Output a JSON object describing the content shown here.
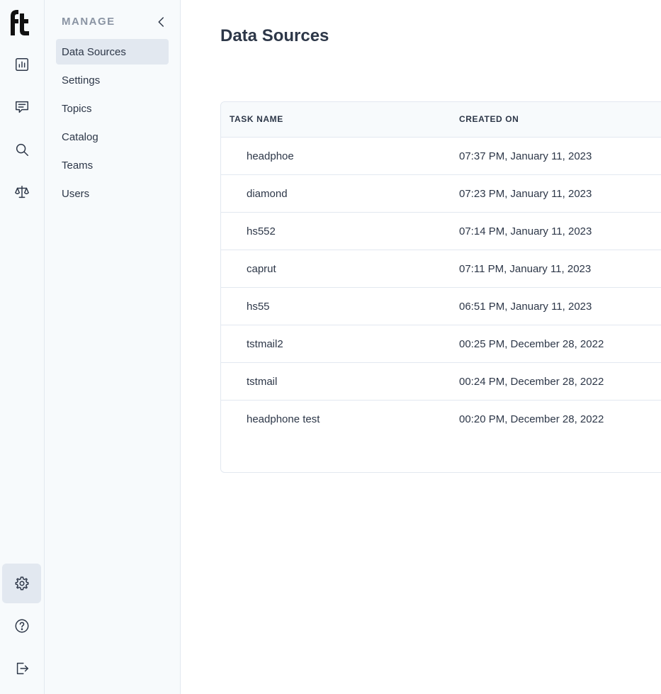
{
  "rail": {
    "logo": "ft",
    "icons": [
      "bar-chart-icon",
      "message-icon",
      "search-icon",
      "scale-icon",
      "gear-icon",
      "help-icon",
      "logout-icon"
    ],
    "active": "gear-icon"
  },
  "panel": {
    "title": "MANAGE",
    "items": [
      {
        "label": "Data Sources",
        "active": true
      },
      {
        "label": "Settings",
        "active": false
      },
      {
        "label": "Topics",
        "active": false
      },
      {
        "label": "Catalog",
        "active": false
      },
      {
        "label": "Teams",
        "active": false
      },
      {
        "label": "Users",
        "active": false
      }
    ]
  },
  "main": {
    "title": "Data Sources",
    "table": {
      "columns": [
        "TASK NAME",
        "CREATED ON"
      ],
      "rows": [
        {
          "name": "headphoe",
          "created": "07:37 PM, January 11, 2023"
        },
        {
          "name": "diamond",
          "created": "07:23 PM, January 11, 2023"
        },
        {
          "name": "hs552",
          "created": "07:14 PM, January 11, 2023"
        },
        {
          "name": "caprut",
          "created": "07:11 PM, January 11, 2023"
        },
        {
          "name": "hs55",
          "created": "06:51 PM, January 11, 2023"
        },
        {
          "name": "tstmail2",
          "created": "00:25 PM, December 28, 2022"
        },
        {
          "name": "tstmail",
          "created": "00:24 PM, December 28, 2022"
        },
        {
          "name": "headphone test",
          "created": "00:20 PM, December 28, 2022"
        }
      ]
    }
  },
  "colors": {
    "sidebar_bg": "#f7fafc",
    "active_bg": "#e2e8f0",
    "text": "#2d3748",
    "muted": "#8a94a3",
    "border": "#e2e8f0"
  }
}
